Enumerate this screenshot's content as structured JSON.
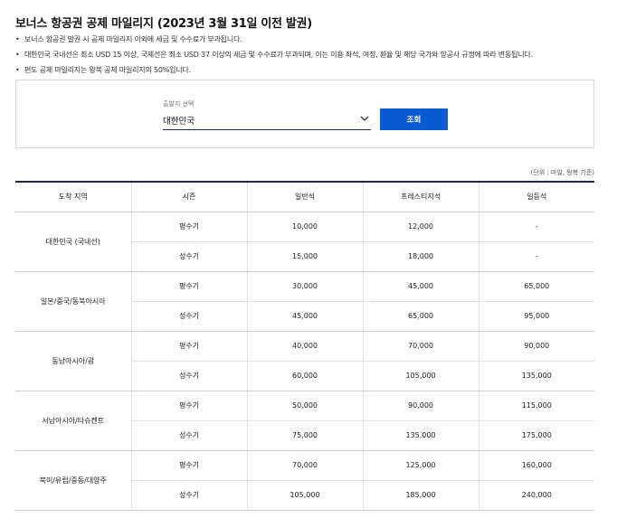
{
  "page": {
    "title": "보너스 항공권 공제 마일리지 (2023년 3월 31일 이전 발권)",
    "notes": [
      "보너스 항공권 발권 시 공제 마일리지 이외에 세금 및 수수료가 부과됩니다.",
      "대한민국 국내선은 최소 USD 15 이상, 국제선은 최소 USD 37 이상의 세금 및 수수료가 부과되며, 이는 이용 좌석, 여정, 환율 및 해당 국가와 항공사 규정에 따라 변동됩니다.",
      "편도 공제 마일리지는 왕복 공제 마일리지의 50%입니다."
    ],
    "note_bullet": "•"
  },
  "search": {
    "label": "출발지 선택",
    "selected": "대한민국",
    "button_label": "조회"
  },
  "table": {
    "unit_note": "(단위 : 마일, 왕복 기준)",
    "headers": [
      "도착 지역",
      "시즌",
      "일반석",
      "프레스티지석",
      "일등석"
    ],
    "regions": [
      {
        "name": "대한민국 (국내선)",
        "rows": [
          {
            "season": "평수기",
            "economy": "10,000",
            "prestige": "12,000",
            "first": "-"
          },
          {
            "season": "성수기",
            "economy": "15,000",
            "prestige": "18,000",
            "first": "-"
          }
        ]
      },
      {
        "name": "일본/중국/동북아시아",
        "rows": [
          {
            "season": "평수기",
            "economy": "30,000",
            "prestige": "45,000",
            "first": "65,000"
          },
          {
            "season": "성수기",
            "economy": "45,000",
            "prestige": "65,000",
            "first": "95,000"
          }
        ]
      },
      {
        "name": "동남아시아/괌",
        "rows": [
          {
            "season": "평수기",
            "economy": "40,000",
            "prestige": "70,000",
            "first": "90,000"
          },
          {
            "season": "성수기",
            "economy": "60,000",
            "prestige": "105,000",
            "first": "135,000"
          }
        ]
      },
      {
        "name": "서남아시아/타슈켄트",
        "rows": [
          {
            "season": "평수기",
            "economy": "50,000",
            "prestige": "90,000",
            "first": "115,000"
          },
          {
            "season": "성수기",
            "economy": "75,000",
            "prestige": "135,000",
            "first": "175,000"
          }
        ]
      },
      {
        "name": "북미/유럽/중동/대양주",
        "rows": [
          {
            "season": "평수기",
            "economy": "70,000",
            "prestige": "125,000",
            "first": "160,000"
          },
          {
            "season": "성수기",
            "economy": "105,000",
            "prestige": "185,000",
            "first": "240,000"
          }
        ]
      }
    ]
  },
  "icons": {
    "select_chevron": "chevron-down-icon"
  },
  "colors": {
    "primary": "#0a5ad4",
    "header_border": "#1b2a4a"
  }
}
